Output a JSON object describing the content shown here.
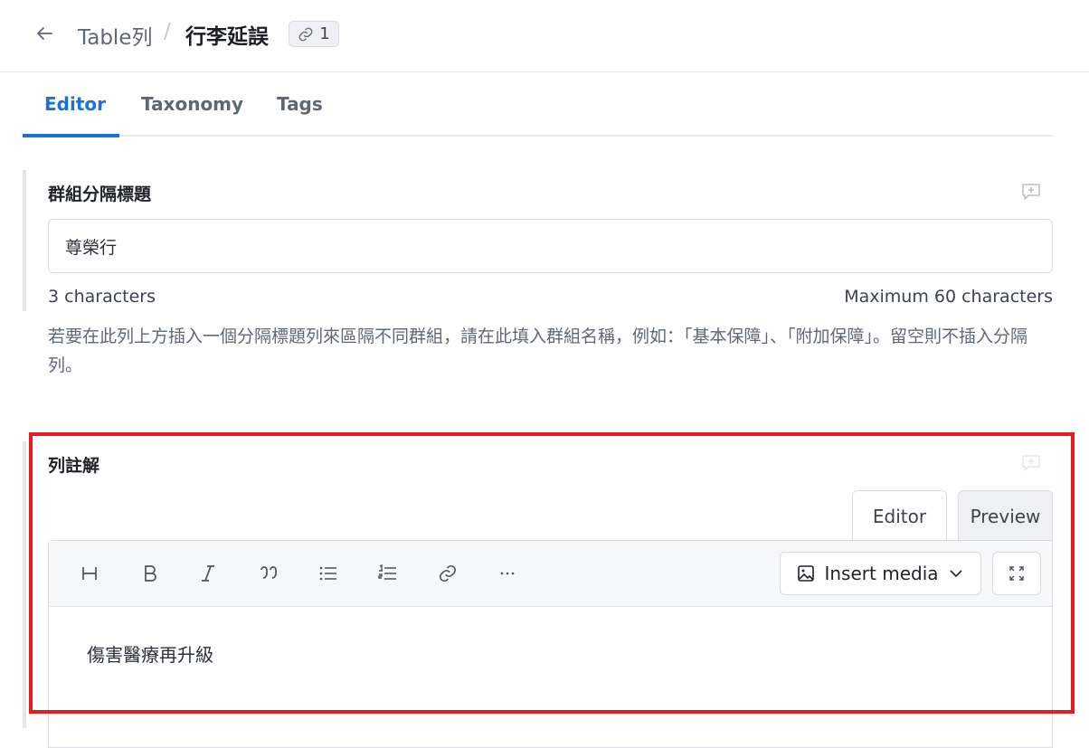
{
  "header": {
    "back_icon": "arrow-left-icon",
    "breadcrumb": "Table列",
    "separator": "/",
    "title": "行李延誤",
    "link_icon": "link-icon",
    "link_count": "1"
  },
  "tabs": [
    {
      "label": "Editor",
      "active": true
    },
    {
      "label": "Taxonomy",
      "active": false
    },
    {
      "label": "Tags",
      "active": false
    }
  ],
  "group_title_field": {
    "label": "群組分隔標題",
    "value": "尊榮行",
    "char_count": "3 characters",
    "max_chars": "Maximum 60 characters",
    "help": "若要在此列上方插入一個分隔標題列來區隔不同群組，請在此填入群組名稱，例如：「基本保障」、「附加保障」。留空則不插入分隔列。",
    "comment_icon": "add-comment-icon"
  },
  "row_note_field": {
    "label": "列註解",
    "comment_icon": "add-comment-icon",
    "mode_editor": "Editor",
    "mode_preview": "Preview",
    "toolbar_icons": [
      "heading-icon",
      "bold-icon",
      "italic-icon",
      "quote-icon",
      "bullet-list-icon",
      "numbered-list-icon",
      "link-icon",
      "more-icon"
    ],
    "insert_media": "Insert media",
    "content": "傷害醫療再升級"
  },
  "colors": {
    "accent": "#1a73d4",
    "highlight": "#e41e1e"
  }
}
